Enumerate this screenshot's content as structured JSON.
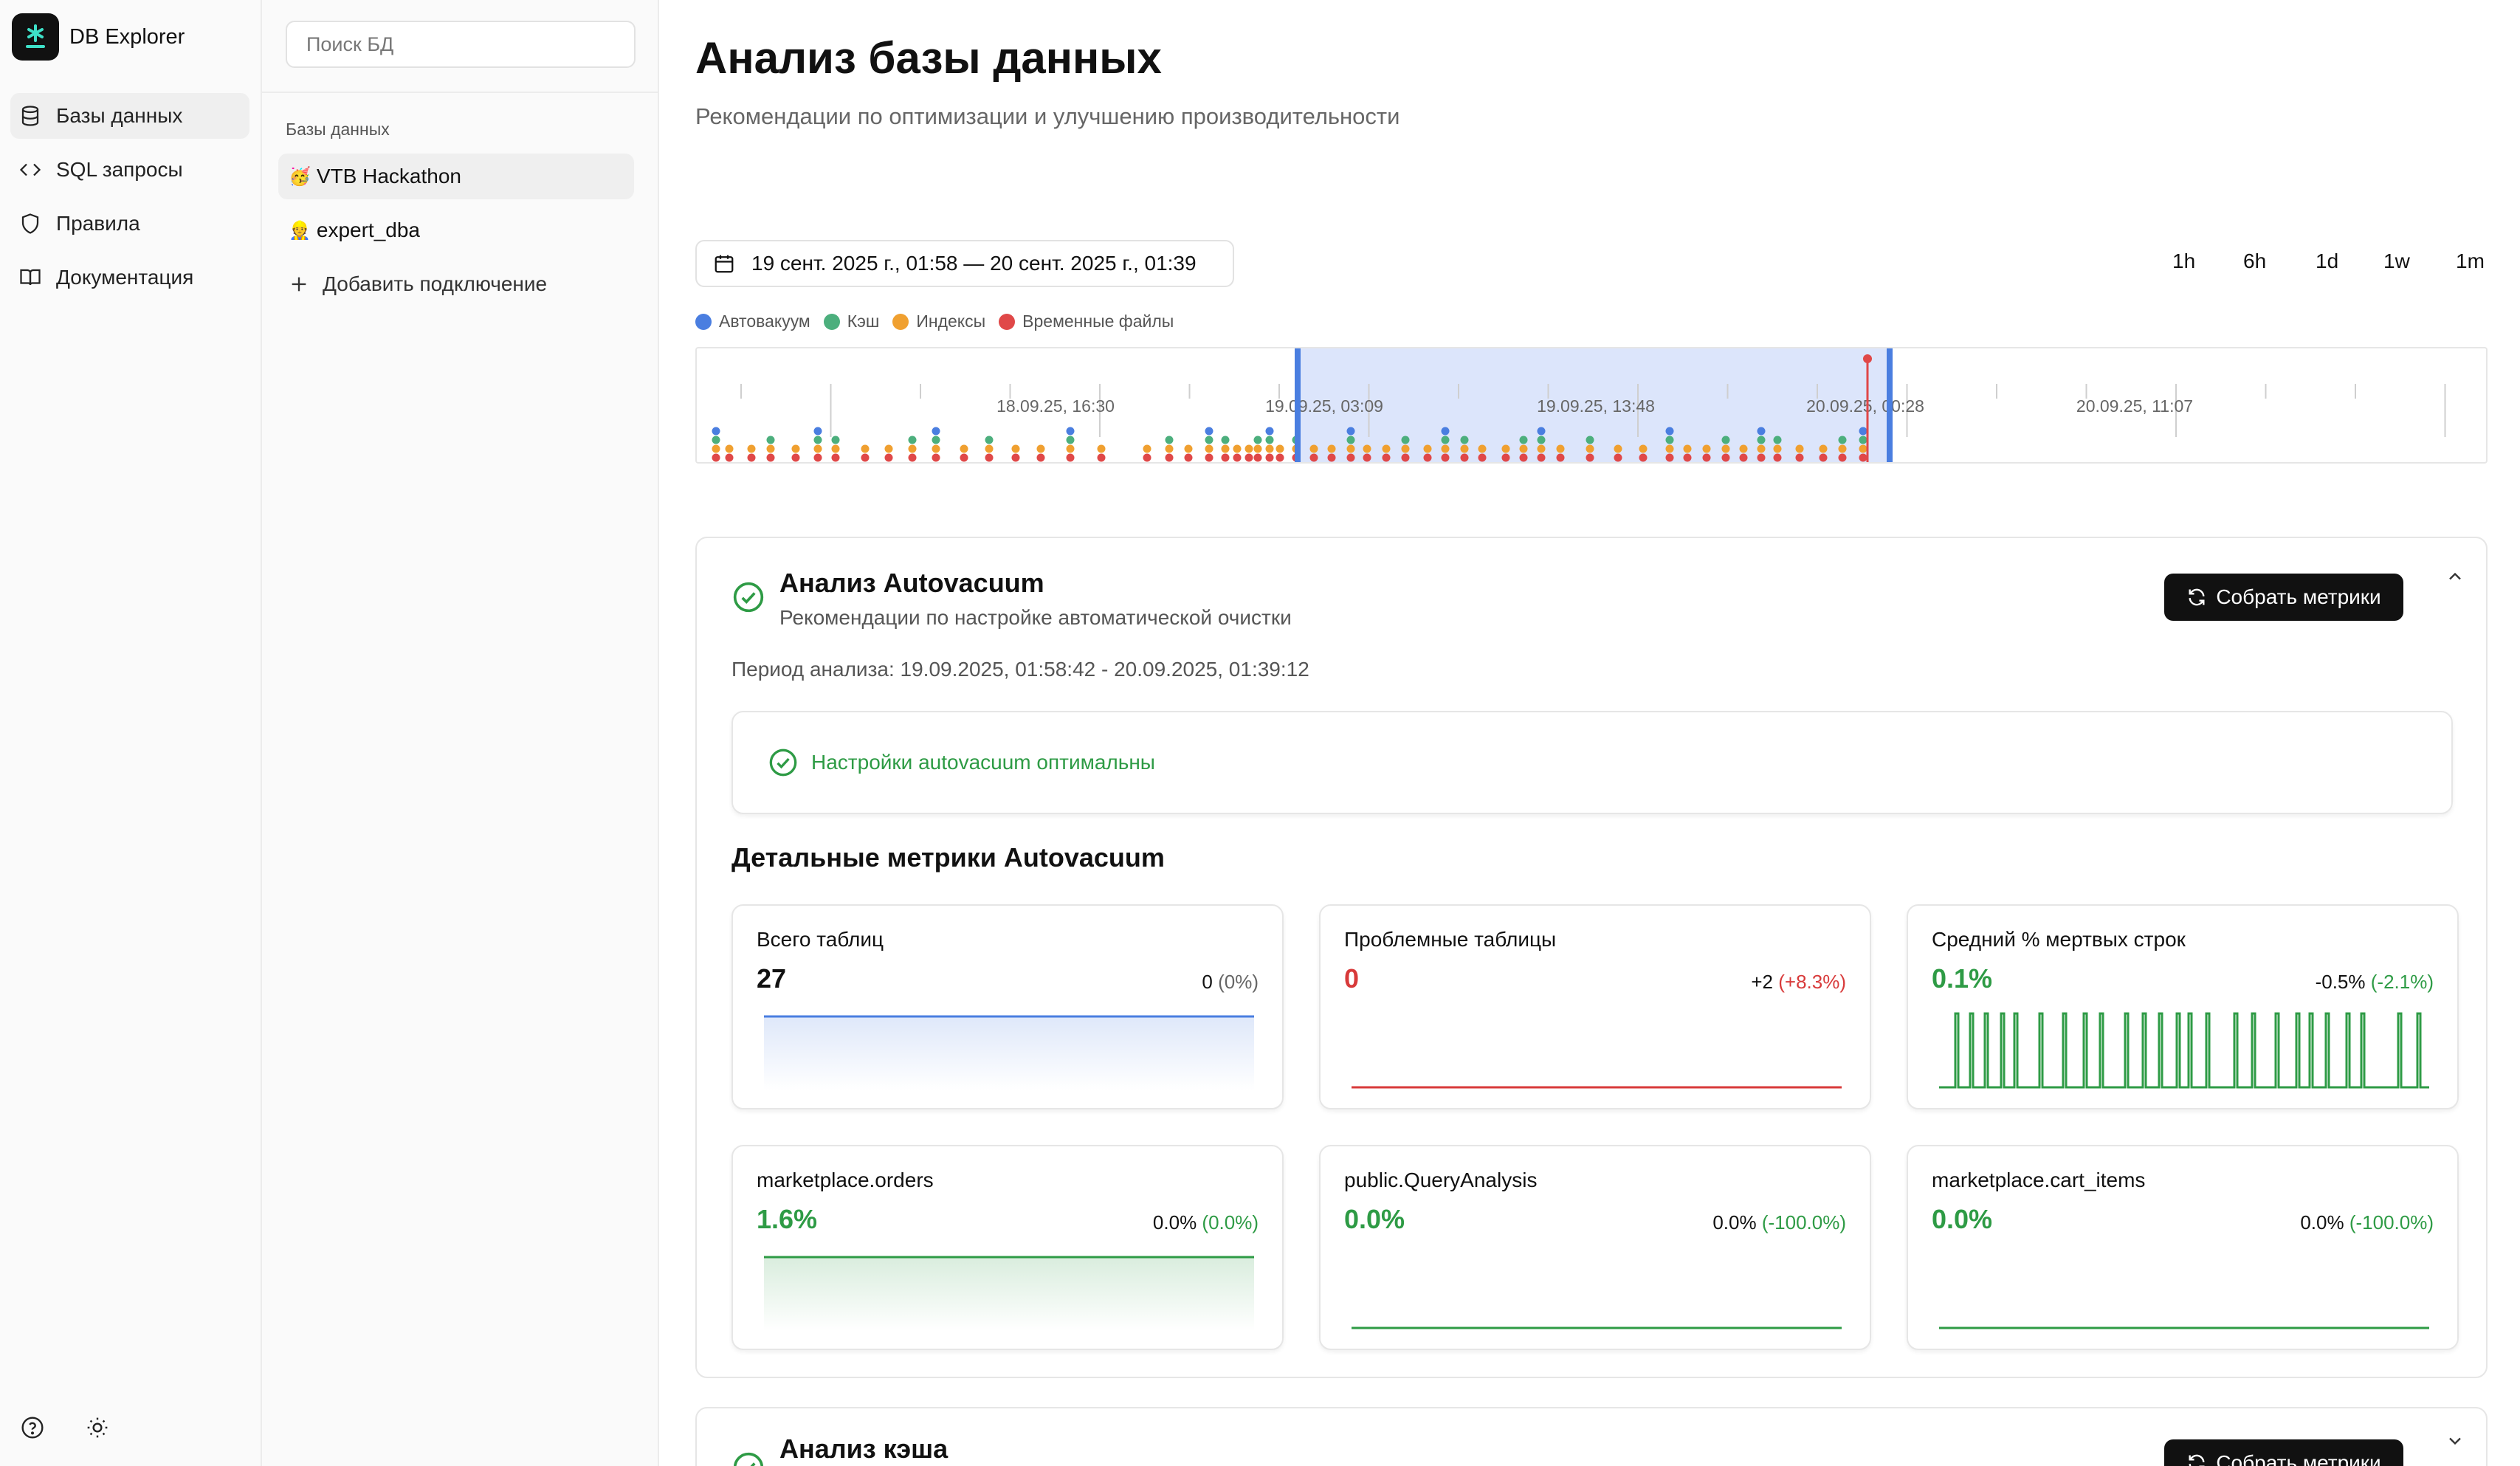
{
  "app": {
    "name": "DB Explorer"
  },
  "nav": {
    "items": [
      {
        "label": "Базы данных",
        "icon": "database-icon",
        "active": true
      },
      {
        "label": "SQL запросы",
        "icon": "code-icon",
        "active": false
      },
      {
        "label": "Правила",
        "icon": "shield-icon",
        "active": false
      },
      {
        "label": "Документация",
        "icon": "book-icon",
        "active": false
      }
    ],
    "footer_icons": [
      "help-icon",
      "sun-icon"
    ]
  },
  "dblist": {
    "search_placeholder": "Поиск БД",
    "heading": "Базы данных",
    "items": [
      {
        "emoji": "🥳",
        "label": "VTB Hackathon",
        "active": true
      },
      {
        "emoji": "👷",
        "label": "expert_dba",
        "active": false
      }
    ],
    "add_label": "Добавить подключение"
  },
  "page": {
    "title": "Анализ базы данных",
    "subtitle": "Рекомендации по оптимизации и улучшению производительности"
  },
  "timeline": {
    "date_range": "19 сент. 2025 г., 01:58 — 20 сент. 2025 г., 01:39",
    "ranges": [
      "1h",
      "6h",
      "1d",
      "1w",
      "1m"
    ],
    "legend": [
      {
        "label": "Автовакуум",
        "color": "#4a7ee0"
      },
      {
        "label": "Кэш",
        "color": "#4caf7d"
      },
      {
        "label": "Индексы",
        "color": "#f0a030"
      },
      {
        "label": "Временные файлы",
        "color": "#e04848"
      }
    ],
    "tick_labels": [
      "18.09.25, 16:30",
      "19.09.25, 03:09",
      "19.09.25, 13:48",
      "20.09.25, 00:28",
      "20.09.25, 11:07"
    ],
    "colors": {
      "selection_fill": "#dce5fb",
      "selection_edge": "#4a7ee0",
      "marker": "#e04848"
    }
  },
  "autovacuum": {
    "title": "Анализ Autovacuum",
    "subtitle": "Рекомендации по настройке автоматической очистки",
    "collect_label": "Собрать метрики",
    "period": "Период анализа: 19.09.2025, 01:58:42 - 20.09.2025, 01:39:12",
    "status": "Настройки autovacuum оптимальны",
    "metrics_heading": "Детальные метрики Autovacuum",
    "metrics": [
      {
        "label": "Всего таблиц",
        "value": "27",
        "delta": "0",
        "delta_pct": "(0%)",
        "value_color": "#111111",
        "pct_color": "#666666",
        "spark": "area",
        "spark_color": "#4a7ee0"
      },
      {
        "label": "Проблемные таблицы",
        "value": "0",
        "delta": "+2",
        "delta_pct": "(+8.3%)",
        "value_color": "#d83a3a",
        "pct_color": "#d83a3a",
        "spark": "flat",
        "spark_color": "#d83a3a"
      },
      {
        "label": "Средний % мертвых строк",
        "value": "0.1%",
        "delta": "-0.5%",
        "delta_pct": "(-2.1%)",
        "value_color": "#2e9b45",
        "pct_color": "#2e9b45",
        "spark": "spikes",
        "spark_color": "#2e9b45"
      },
      {
        "label": "marketplace.orders",
        "value": "1.6%",
        "delta": "0.0%",
        "delta_pct": "(0.0%)",
        "value_color": "#2e9b45",
        "pct_color": "#2e9b45",
        "spark": "area",
        "spark_color": "#2e9b45"
      },
      {
        "label": "public.QueryAnalysis",
        "value": "0.0%",
        "delta": "0.0%",
        "delta_pct": "(-100.0%)",
        "value_color": "#2e9b45",
        "pct_color": "#2e9b45",
        "spark": "flat",
        "spark_color": "#2e9b45"
      },
      {
        "label": "marketplace.cart_items",
        "value": "0.0%",
        "delta": "0.0%",
        "delta_pct": "(-100.0%)",
        "value_color": "#2e9b45",
        "pct_color": "#2e9b45",
        "spark": "flat",
        "spark_color": "#2e9b45"
      }
    ]
  },
  "cache": {
    "title": "Анализ кэша",
    "collect_label": "Собрать метрики"
  }
}
